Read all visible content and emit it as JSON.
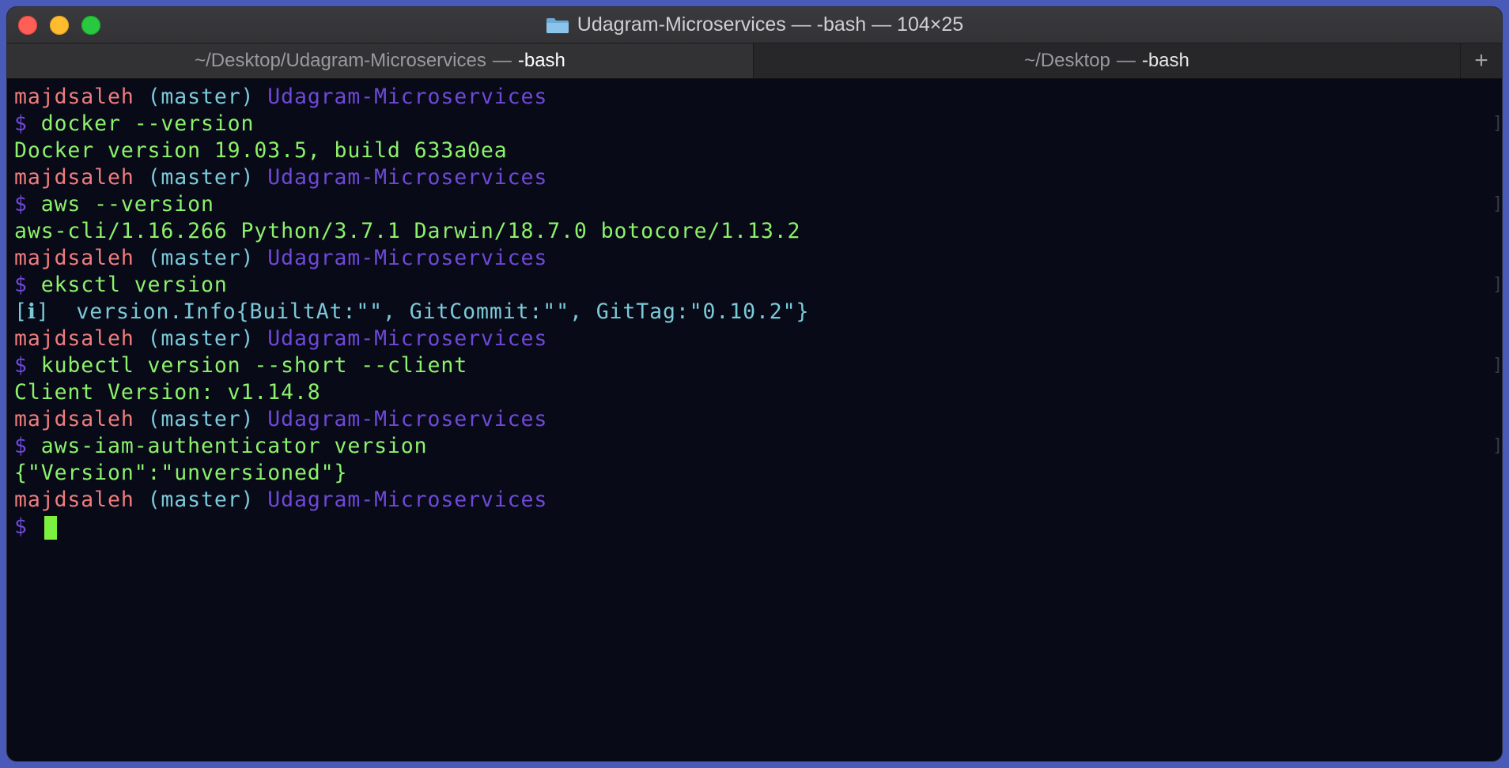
{
  "window": {
    "title": "Udagram-Microservices — -bash — 104×25"
  },
  "tabs": [
    {
      "dir": "~/Desktop/Udagram-Microservices",
      "dash": "—",
      "cmd": "-bash",
      "active": true
    },
    {
      "dir": "~/Desktop",
      "dash": "—",
      "cmd": "-bash",
      "active": false
    }
  ],
  "new_tab_label": "+",
  "terminal": {
    "colors": {
      "user": "#f07c7c",
      "branch": "#7ccad9",
      "directory": "#6f48d8",
      "command": "#8cf26a",
      "background": "#080a18"
    },
    "prompt": {
      "user": "majdsaleh",
      "branch": "(master)",
      "dir": "Udagram-Microservices",
      "symbol": "$"
    },
    "blocks": [
      {
        "command": "docker --version",
        "output": "Docker version 19.03.5, build 633a0ea"
      },
      {
        "command": "aws --version",
        "output": "aws-cli/1.16.266 Python/3.7.1 Darwin/18.7.0 botocore/1.13.2"
      },
      {
        "command": "eksctl version",
        "output": "[ℹ]  version.Info{BuiltAt:\"\", GitCommit:\"\", GitTag:\"0.10.2\"}"
      },
      {
        "command": "kubectl version --short --client",
        "output": "Client Version: v1.14.8"
      },
      {
        "command": "aws-iam-authenticator version",
        "output": "{\"Version\":\"unversioned\"}"
      }
    ]
  }
}
